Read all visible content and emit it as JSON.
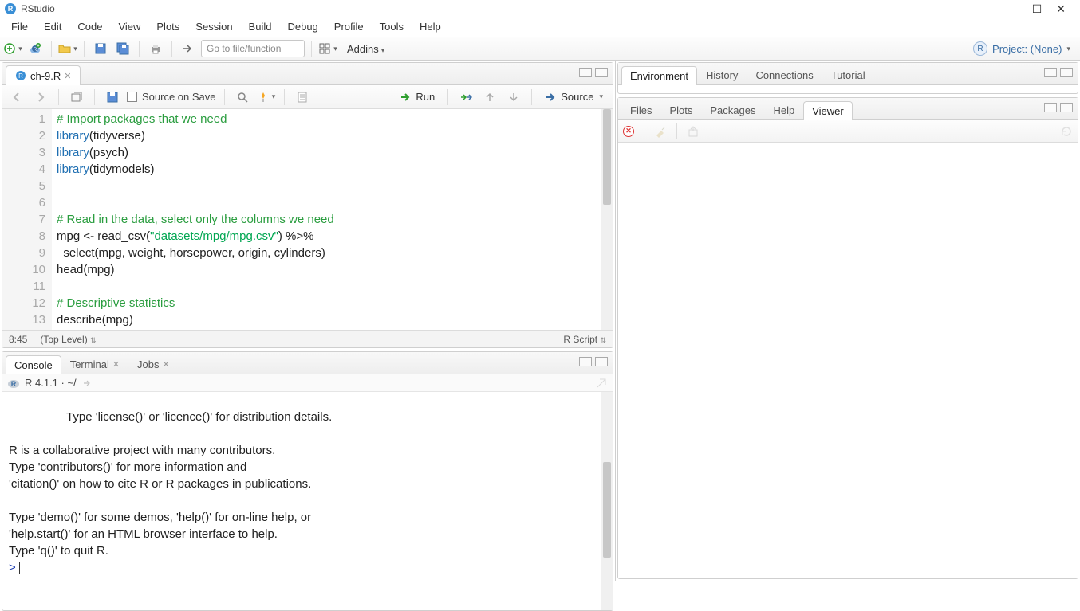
{
  "window": {
    "title": "RStudio"
  },
  "menubar": [
    "File",
    "Edit",
    "Code",
    "View",
    "Plots",
    "Session",
    "Build",
    "Debug",
    "Profile",
    "Tools",
    "Help"
  ],
  "maintoolbar": {
    "goto_placeholder": "Go to file/function",
    "addins": "Addins",
    "project": "Project: (None)"
  },
  "source": {
    "tab": "ch-9.R",
    "source_on_save": "Source on Save",
    "run": "Run",
    "source_btn": "Source",
    "cursor": "8:45",
    "scope": "(Top Level)",
    "type": "R Script",
    "lines": [
      {
        "n": "1",
        "html": "<span class='cm'># Import packages that we need</span>"
      },
      {
        "n": "2",
        "html": "<span class='kw'>library</span>(tidyverse)"
      },
      {
        "n": "3",
        "html": "<span class='kw'>library</span>(psych)"
      },
      {
        "n": "4",
        "html": "<span class='kw'>library</span>(tidymodels)"
      },
      {
        "n": "5",
        "html": ""
      },
      {
        "n": "6",
        "html": ""
      },
      {
        "n": "7",
        "html": "<span class='cm'># Read in the data, select only the columns we need</span>"
      },
      {
        "n": "8",
        "html": "mpg &lt;- read_csv(<span class='str'>\"datasets/mpg/mpg.csv\"</span>) %&gt;% "
      },
      {
        "n": "9",
        "html": "  select(mpg, weight, horsepower, origin, cylinders)"
      },
      {
        "n": "10",
        "html": "head(mpg)"
      },
      {
        "n": "11",
        "html": ""
      },
      {
        "n": "12",
        "html": "<span class='cm'># Descriptive statistics</span>"
      },
      {
        "n": "13",
        "html": "describe(mpg)"
      }
    ]
  },
  "console": {
    "tabs": [
      "Console",
      "Terminal",
      "Jobs"
    ],
    "info": "R 4.1.1 · ~/",
    "text": "Type 'license()' or 'licence()' for distribution details.\n\nR is a collaborative project with many contributors.\nType 'contributors()' for more information and\n'citation()' on how to cite R or R packages in publications.\n\nType 'demo()' for some demos, 'help()' for on-line help, or\n'help.start()' for an HTML browser interface to help.\nType 'q()' to quit R.\n",
    "prompt": "> "
  },
  "right_top_tabs": [
    "Environment",
    "History",
    "Connections",
    "Tutorial"
  ],
  "right_bot_tabs": [
    "Files",
    "Plots",
    "Packages",
    "Help",
    "Viewer"
  ]
}
